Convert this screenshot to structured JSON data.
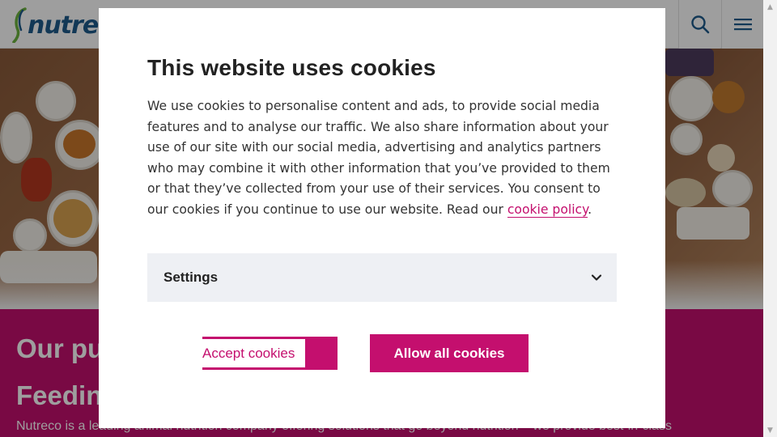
{
  "header": {
    "logo_text": "nutreco",
    "search_icon": "search-icon",
    "menu_icon": "hamburger-menu-icon"
  },
  "promo": {
    "title_line1": "Our pu",
    "title_line2": "Feedin",
    "text": "Nutreco is a leading animal nutrition company offering solutions that go beyond nutrition – we provide best-in-class"
  },
  "cookie_dialog": {
    "title": "This website uses cookies",
    "body_text": "We use cookies to personalise content and ads, to provide social media features and to analyse our traffic. We also share information about your use of our site with our social media, advertising and analytics partners who may combine it with other information that you’ve provided to them or that they’ve collected from your use of their services. You consent to our cookies if you continue to use our website. Read our ",
    "link_text": "cookie policy",
    "body_end": ".",
    "settings_label": "Settings",
    "accept_label": "Accept cookies",
    "allow_all_label": "Allow all cookies"
  },
  "colors": {
    "brand": "#c40f6e",
    "logo_blue": "#1e5b8c",
    "settings_bg": "#eef0f4"
  }
}
